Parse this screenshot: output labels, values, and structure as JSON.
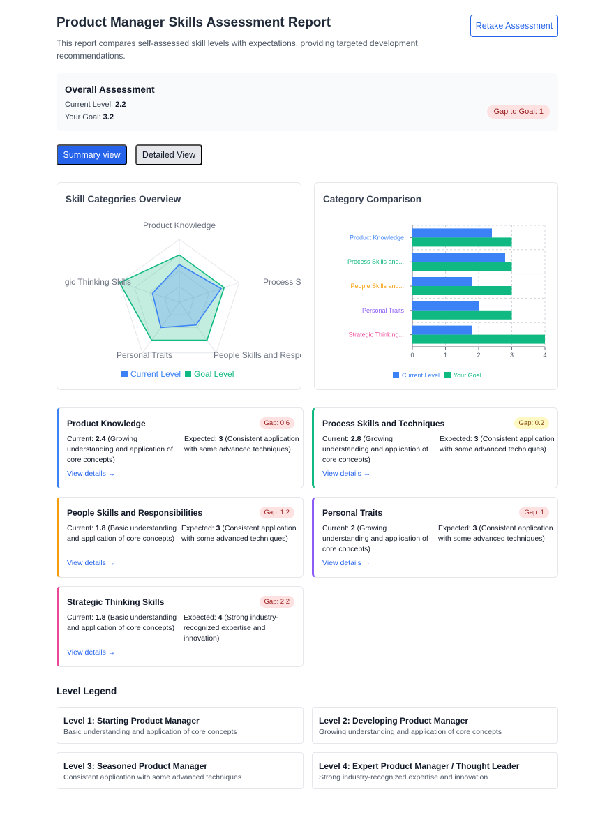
{
  "header": {
    "title": "Product Manager Skills Assessment Report",
    "subtitle": "This report compares self-assessed skill levels with expectations, providing targeted development recommendations.",
    "retake_label": "Retake Assessment"
  },
  "overall": {
    "title": "Overall Assessment",
    "current_label": "Current Level: ",
    "current_value": "2.2",
    "goal_label": "Your Goal: ",
    "goal_value": "3.2",
    "gap_label": "Gap to Goal: 1"
  },
  "view_toggle": {
    "summary_label": "Summary view",
    "detailed_label": "Detailed View"
  },
  "chart_data": [
    {
      "type": "radar",
      "title": "Skill Categories Overview",
      "axes": [
        "Product Knowledge",
        "Process Skills and Techniques",
        "People Skills and Responsibilities",
        "Personal Traits",
        "Strategic Thinking Skills"
      ],
      "axis_display": [
        "Product Knowledge",
        "Process Skills and",
        "People Skills and Respo",
        "Personal Traits",
        "gic Thinking Skills"
      ],
      "max": 4,
      "series": [
        {
          "name": "Current Level",
          "values": [
            2.4,
            2.8,
            1.8,
            2,
            1.8
          ],
          "color": "#3b82f6"
        },
        {
          "name": "Goal Level",
          "values": [
            3,
            3,
            3,
            3,
            4
          ],
          "color": "#10b981"
        }
      ],
      "legend": "bottom"
    },
    {
      "type": "bar",
      "orientation": "horizontal",
      "title": "Category Comparison",
      "categories": [
        "Product Knowledge",
        "Process Skills and...",
        "People Skills and...",
        "Personal Traits",
        "Strategic Thinking..."
      ],
      "category_colors": [
        "#3b82f6",
        "#10b981",
        "#f59e0b",
        "#8b5cf6",
        "#ec4899"
      ],
      "series": [
        {
          "name": "Current Level",
          "values": [
            2.4,
            2.8,
            1.8,
            2,
            1.8
          ],
          "color": "#3b82f6"
        },
        {
          "name": "Your Goal",
          "values": [
            3,
            3,
            3,
            3,
            4
          ],
          "color": "#10b981"
        }
      ],
      "xlim": [
        0,
        4
      ],
      "xticks": [
        "0",
        "1",
        "2",
        "3",
        "4"
      ],
      "grid": true,
      "legend": "bottom"
    }
  ],
  "skills": [
    {
      "name": "Product Knowledge",
      "gap": "Gap: 0.6",
      "current_label": "Current: ",
      "current_value": "2.4",
      "current_desc": " (Growing understanding and application of core concepts)",
      "expected_label": "Expected: ",
      "expected_value": "3",
      "expected_desc": " (Consistent application with some advanced techniques)",
      "link": "View details →",
      "accent": "#3b82f6"
    },
    {
      "name": "Process Skills and Techniques",
      "gap": "Gap: 0.2",
      "current_label": "Current: ",
      "current_value": "2.8",
      "current_desc": " (Growing understanding and application of core concepts)",
      "expected_label": "Expected: ",
      "expected_value": "3",
      "expected_desc": " (Consistent application with some advanced techniques)",
      "link": "View details →",
      "accent": "#10b981"
    },
    {
      "name": "People Skills and Responsibilities",
      "gap": "Gap: 1.2",
      "current_label": "Current: ",
      "current_value": "1.8",
      "current_desc": " (Basic understanding and application of core concepts)",
      "expected_label": "Expected: ",
      "expected_value": "3",
      "expected_desc": " (Consistent application with some advanced techniques)",
      "link": "View details →",
      "accent": "#f59e0b"
    },
    {
      "name": "Personal Traits",
      "gap": "Gap: 1",
      "current_label": "Current: ",
      "current_value": "2",
      "current_desc": " (Growing understanding and application of core concepts)",
      "expected_label": "Expected: ",
      "expected_value": "3",
      "expected_desc": " (Consistent application with some advanced techniques)",
      "link": "View details →",
      "accent": "#8b5cf6"
    },
    {
      "name": "Strategic Thinking Skills",
      "gap": "Gap: 2.2",
      "current_label": "Current: ",
      "current_value": "1.8",
      "current_desc": " (Basic understanding and application of core concepts)",
      "expected_label": "Expected: ",
      "expected_value": "4",
      "expected_desc": " (Strong industry-recognized expertise and innovation)",
      "link": "View details →",
      "accent": "#ec4899"
    }
  ],
  "level_legend": {
    "title": "Level Legend",
    "levels": [
      {
        "name": "Level 1: Starting Product Manager",
        "desc": "Basic understanding and application of core concepts"
      },
      {
        "name": "Level 2: Developing Product Manager",
        "desc": "Growing understanding and application of core concepts"
      },
      {
        "name": "Level 3: Seasoned Product Manager",
        "desc": "Consistent application with some advanced techniques"
      },
      {
        "name": "Level 4: Expert Product Manager / Thought Leader",
        "desc": "Strong industry-recognized expertise and innovation"
      }
    ]
  }
}
